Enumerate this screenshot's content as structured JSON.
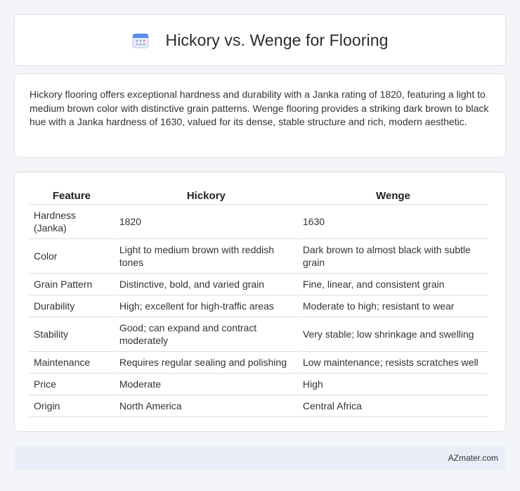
{
  "header": {
    "title": "Hickory vs. Wenge for Flooring",
    "icon": "calendar-icon"
  },
  "intro": {
    "text": "Hickory flooring offers exceptional hardness and durability with a Janka rating of 1820, featuring a light to medium brown color with distinctive grain patterns. Wenge flooring provides a striking dark brown to black hue with a Janka hardness of 1630, valued for its dense, stable structure and rich, modern aesthetic."
  },
  "table": {
    "headers": [
      "Feature",
      "Hickory",
      "Wenge"
    ],
    "rows": [
      [
        "Hardness (Janka)",
        "1820",
        "1630"
      ],
      [
        "Color",
        "Light to medium brown with reddish tones",
        "Dark brown to almost black with subtle grain"
      ],
      [
        "Grain Pattern",
        "Distinctive, bold, and varied grain",
        "Fine, linear, and consistent grain"
      ],
      [
        "Durability",
        "High; excellent for high-traffic areas",
        "Moderate to high; resistant to wear"
      ],
      [
        "Stability",
        "Good; can expand and contract moderately",
        "Very stable; low shrinkage and swelling"
      ],
      [
        "Maintenance",
        "Requires regular sealing and polishing",
        "Low maintenance; resists scratches well"
      ],
      [
        "Price",
        "Moderate",
        "High"
      ],
      [
        "Origin",
        "North America",
        "Central Africa"
      ]
    ]
  },
  "footer": {
    "text": "AZmater.com"
  },
  "colors": {
    "background": "#f4f5f8",
    "card": "#ffffff",
    "footer": "#e8edf7",
    "icon_accent": "#5b8def"
  }
}
